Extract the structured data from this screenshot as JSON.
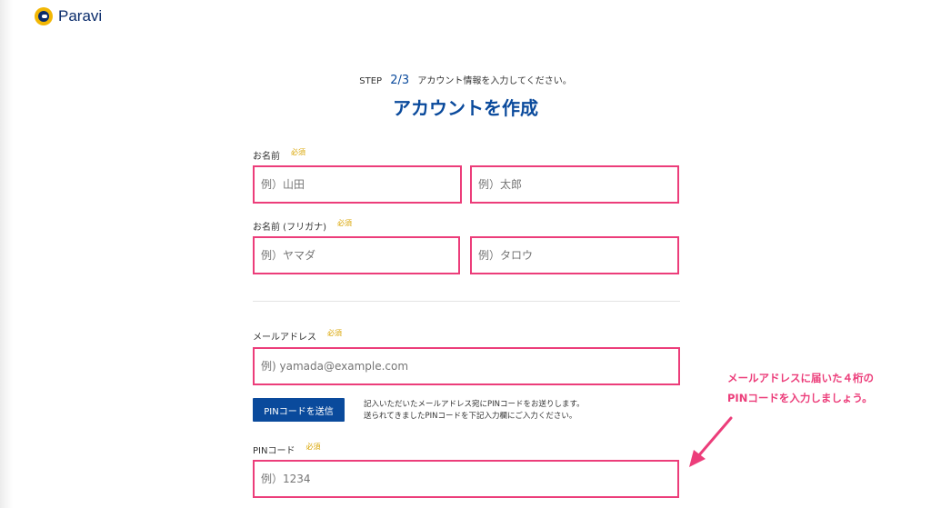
{
  "brand": {
    "name": "Paravi"
  },
  "step": {
    "prefix": "STEP",
    "number": "2/3",
    "description": "アカウント情報を入力してください。"
  },
  "title": "アカウントを作成",
  "required_badge": "必須",
  "form": {
    "name": {
      "label": "お名前",
      "last_placeholder": "例）山田",
      "first_placeholder": "例）太郎"
    },
    "kana": {
      "label": "お名前 (フリガナ)",
      "last_placeholder": "例）ヤマダ",
      "first_placeholder": "例）タロウ"
    },
    "email": {
      "label": "メールアドレス",
      "placeholder": "例) yamada@example.com"
    },
    "send_pin_button": "PINコードを送信",
    "pin_note_1": "記入いただいたメールアドレス宛にPINコードをお送りします。",
    "pin_note_2": "送られてきましたPINコードを下記入力欄にご入力ください。",
    "pin": {
      "label": "PINコード",
      "placeholder": "例）1234"
    }
  },
  "annotation": {
    "line1": "メールアドレスに届いた４桁の",
    "line2": "PINコードを入力しましょう。"
  },
  "colors": {
    "brand_blue": "#0a4a9c",
    "highlight_pink": "#ec3d7a",
    "required_gold": "#d9a400"
  }
}
